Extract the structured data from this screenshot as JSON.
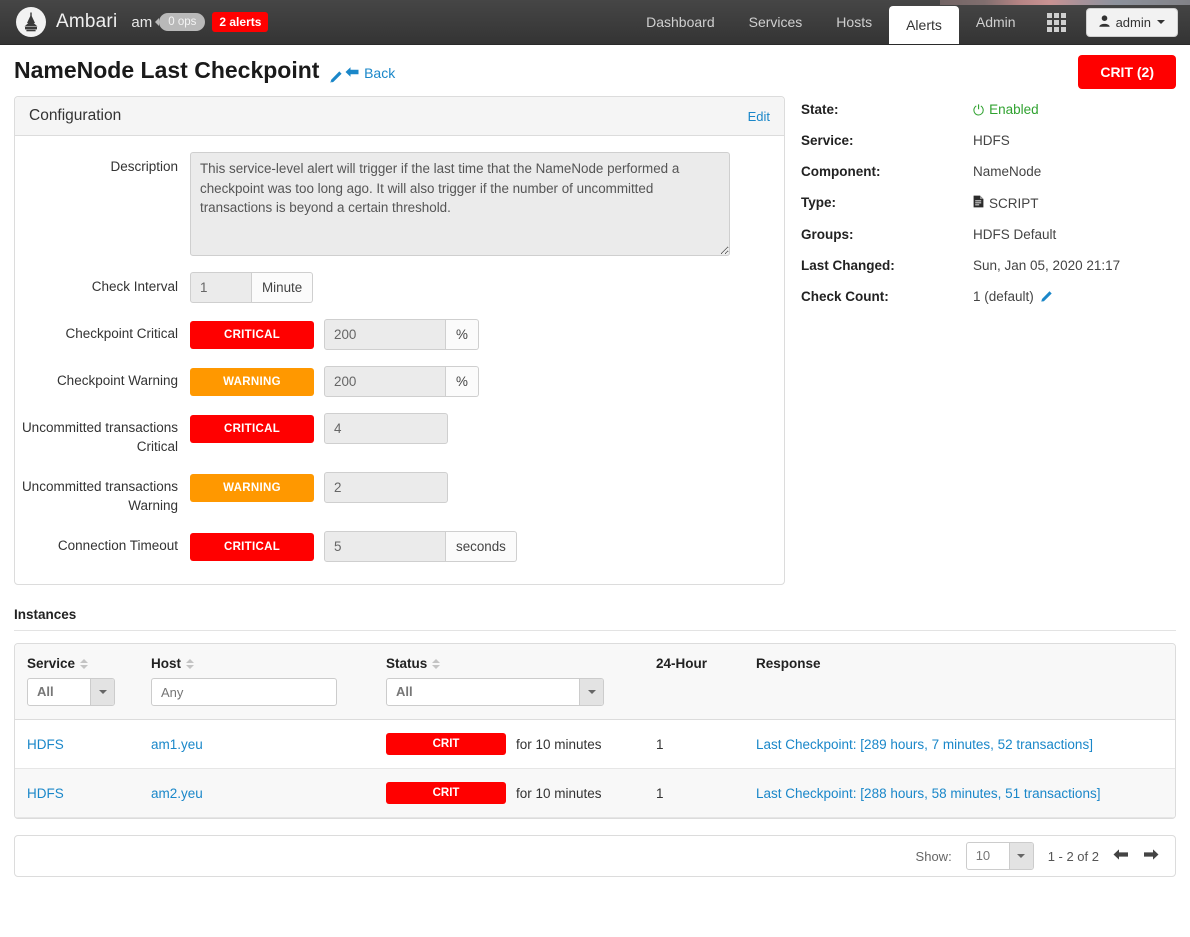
{
  "navbar": {
    "logo_icon": "ambari-logo-icon",
    "brand": "Ambari",
    "cluster_name": "am",
    "ops_badge": "0 ops",
    "alerts_badge": "2 alerts",
    "items": [
      {
        "label": "Dashboard",
        "active": false
      },
      {
        "label": "Services",
        "active": false
      },
      {
        "label": "Hosts",
        "active": false
      },
      {
        "label": "Alerts",
        "active": true
      },
      {
        "label": "Admin",
        "active": false
      }
    ],
    "grid_icon": "grid-apps-icon",
    "user_icon": "user-icon",
    "user_label": "admin"
  },
  "page": {
    "title": "NameNode Last Checkpoint",
    "title_edit_icon": "pencil-icon",
    "back_label": "Back",
    "back_icon": "arrow-left-icon",
    "status_pill": "CRIT (2)"
  },
  "configuration": {
    "panel_title": "Configuration",
    "edit_label": "Edit",
    "description_label": "Description",
    "description_value": "This service-level alert will trigger if the last time that the NameNode performed a checkpoint was too long ago. It will also trigger if the number of uncommitted transactions is beyond a certain threshold.",
    "rows": [
      {
        "label": "Check Interval",
        "severity": null,
        "value": "1",
        "unit": "Minute",
        "input_width": 62
      },
      {
        "label": "Checkpoint Critical",
        "severity": "CRITICAL",
        "severity_kind": "critical",
        "value": "200",
        "unit": "%",
        "input_width": 122
      },
      {
        "label": "Checkpoint Warning",
        "severity": "WARNING",
        "severity_kind": "warning",
        "value": "200",
        "unit": "%",
        "input_width": 122
      },
      {
        "label": "Uncommitted transactions Critical",
        "severity": "CRITICAL",
        "severity_kind": "critical",
        "value": "4",
        "unit": null,
        "input_width": 124
      },
      {
        "label": "Uncommitted transactions Warning",
        "severity": "WARNING",
        "severity_kind": "warning",
        "value": "2",
        "unit": null,
        "input_width": 124
      },
      {
        "label": "Connection Timeout",
        "severity": "CRITICAL",
        "severity_kind": "critical",
        "value": "5",
        "unit": "seconds",
        "input_width": 122
      }
    ]
  },
  "details": {
    "rows": [
      {
        "key": "State:",
        "value": "Enabled",
        "icon": "power-icon",
        "edit_icon": null
      },
      {
        "key": "Service:",
        "value": "HDFS",
        "icon": null,
        "edit_icon": null
      },
      {
        "key": "Component:",
        "value": "NameNode",
        "icon": null,
        "edit_icon": null
      },
      {
        "key": "Type:",
        "value": "SCRIPT",
        "icon": "script-icon",
        "edit_icon": null
      },
      {
        "key": "Groups:",
        "value": "HDFS Default",
        "icon": null,
        "edit_icon": null
      },
      {
        "key": "Last Changed:",
        "value": "Sun, Jan 05, 2020 21:17",
        "icon": null,
        "edit_icon": null
      },
      {
        "key": "Check Count:",
        "value": "1 (default)",
        "icon": null,
        "edit_icon": "pencil-icon"
      }
    ]
  },
  "instances": {
    "section_title": "Instances",
    "columns": [
      {
        "label": "Service",
        "sortable": true,
        "filter": "select",
        "filter_value": "All"
      },
      {
        "label": "Host",
        "sortable": true,
        "filter": "text",
        "filter_value": "",
        "filter_placeholder": "Any"
      },
      {
        "label": "Status",
        "sortable": true,
        "filter": "select",
        "filter_value": "All"
      },
      {
        "label": "24-Hour",
        "sortable": false,
        "filter": null
      },
      {
        "label": "Response",
        "sortable": false,
        "filter": null
      }
    ],
    "rows": [
      {
        "service": "HDFS",
        "host": "am1.yeu",
        "status_chip": "CRIT",
        "status_duration": "for 10 minutes",
        "count_24h": "1",
        "response": "Last Checkpoint: [289 hours, 7 minutes, 52 transactions]"
      },
      {
        "service": "HDFS",
        "host": "am2.yeu",
        "status_chip": "CRIT",
        "status_duration": "for 10 minutes",
        "count_24h": "1",
        "response": "Last Checkpoint: [288 hours, 58 minutes, 51 transactions]"
      }
    ],
    "pager": {
      "show_label": "Show:",
      "page_size": "10",
      "range_text": "1 - 2 of 2",
      "prev_icon": "arrow-left-icon",
      "next_icon": "arrow-right-icon"
    }
  },
  "colors": {
    "critical": "#ff0000",
    "warning": "#ff9800",
    "link": "#1a87c9",
    "enabled": "#30a230",
    "navbar": "#3b3b3b"
  }
}
